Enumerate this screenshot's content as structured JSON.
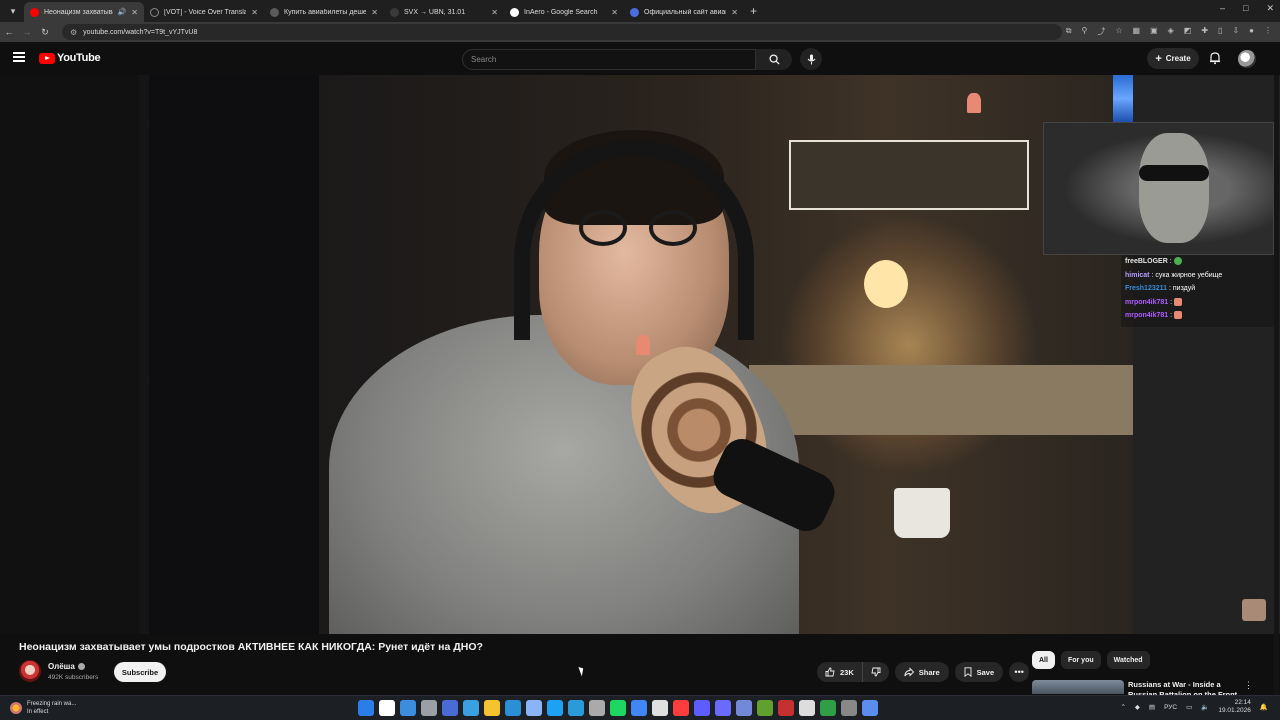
{
  "browser": {
    "tabs": [
      {
        "title": "Неонацизм захватывает у",
        "active": true,
        "favicon_color": "#ff0000",
        "audio": true
      },
      {
        "title": "[VOT] - Voice Over Translation",
        "active": false,
        "favicon_color": "#222222"
      },
      {
        "title": "Купить авиабилеты дешево с",
        "active": false,
        "favicon_color": "#5a5a5a"
      },
      {
        "title": "SVX → UBN, 31.01",
        "active": false,
        "favicon_color": "#3a3a3a"
      },
      {
        "title": "InAero - Google Search",
        "active": false,
        "favicon_color": "#ffffff"
      },
      {
        "title": "Официальный сайт авиакомп",
        "active": false,
        "favicon_color": "#4a6ee0"
      }
    ],
    "new_tab_label": "+",
    "url": "youtube.com/watch?v=T9t_vYJTvU8",
    "window_controls": [
      "–",
      "□",
      "✕"
    ]
  },
  "youtube": {
    "logo_text": "YouTube",
    "search_placeholder": "Search",
    "create_label": "Create",
    "video": {
      "title": "Неонацизм захватывает умы подростков АКТИВНЕЕ КАК НИКОГДА: Рунет идёт на ДНО?",
      "channel_name": "Олёша",
      "subscribers": "492K subscribers",
      "subscribe_label": "Subscribe",
      "likes": "23K",
      "share_label": "Share",
      "save_label": "Save"
    },
    "chat_overlay": [
      {
        "user": "freeBLOGER",
        "message": ":",
        "emote_color": "#4caf50",
        "user_color": "#e3e3e3"
      },
      {
        "user": "himicat",
        "message": ": сука жирное уебище",
        "emote_color": "",
        "user_color": "#b59cff"
      },
      {
        "user": "Fresh123211",
        "message": ": пиздуй",
        "emote_color": "",
        "user_color": "#3a8bd8"
      },
      {
        "user": "mrpon4ik781",
        "message": ":",
        "emote_color": "#e88a73",
        "user_color": "#b05cff"
      },
      {
        "user": "mrpon4ik781",
        "message": ":",
        "emote_color": "#e88a73",
        "user_color": "#b05cff"
      }
    ],
    "chips": [
      "All",
      "For you",
      "Watched"
    ],
    "recommendation": {
      "title": "Russians at War - Inside a Russian Battalion on the Front"
    }
  },
  "taskbar": {
    "weather_title": "Freezing rain wa...",
    "weather_subtitle": "In effect",
    "language": "РУС",
    "time": "22:14",
    "date": "19.01.2026",
    "app_colors": [
      "#2b7de9",
      "#ffffff",
      "#3c8dde",
      "#9aa0a6",
      "#4a6bd6",
      "#3aa0e0",
      "#f4c430",
      "#2a8fd6",
      "#8ab4f8",
      "#1da1f2",
      "#2a9bd8",
      "#aaaaaa",
      "#1ed760",
      "#4285f4",
      "#e0e0e0",
      "#ff3d3d",
      "#5d5dff",
      "#6a6aff",
      "#7289da",
      "#5fa02e",
      "#c53030",
      "#dddddd",
      "#2f9e44",
      "#888888",
      "#5b8def"
    ]
  }
}
